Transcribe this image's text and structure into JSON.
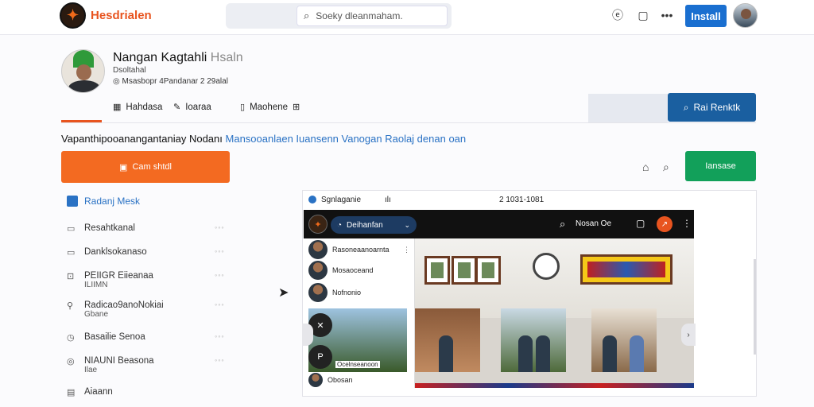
{
  "header": {
    "logo_glyph": "✦",
    "brand": "Hesdrialen",
    "search_placeholder": "Soeky dleanmaham.",
    "install_label": "Install",
    "icons": [
      "help-icon",
      "window-icon",
      "more-icon"
    ]
  },
  "profile": {
    "name": "Nangan Kagtahli",
    "name_suffix": "Hsaln",
    "line1": "Dsoltahal",
    "meta": "Msasbopr 4Pandanar 2 29alal",
    "tabs": [
      {
        "icon": "grid-icon",
        "label": "Hahdasa"
      },
      {
        "icon": "pencil-icon",
        "label": "Ioaraa"
      },
      {
        "icon": "book-icon",
        "label": "Maohene"
      }
    ],
    "tab_extra_icon": "⊞",
    "blue_button": "Rai Renktk",
    "description": "Vapanthipooanangantaniay Nodanı",
    "description_link": "Mansooanlaen Iuansenn Vanogan Raolaj denan oan",
    "orange_button": "Cam shtdl",
    "green_button": "Iansase"
  },
  "sidebar": {
    "heading": "Radanj Mesk",
    "items": [
      {
        "icon": "▭",
        "label": "Resahtkanal",
        "dots": "◦◦◦"
      },
      {
        "icon": "▭",
        "label": "Danklsokanaso",
        "dots": "◦◦◦"
      },
      {
        "icon": "⊡",
        "label": "PEIIGR Eiieanaa",
        "sub": "ILIIMN",
        "dots": "◦◦◦"
      },
      {
        "icon": "⚲",
        "label": "Radicao9anoNokiai",
        "sub": "Gbane",
        "dots": "◦◦◦"
      },
      {
        "icon": "◷",
        "label": "Basailie Senoa",
        "dots": "◦◦◦"
      },
      {
        "icon": "◎",
        "label": "NIAUNI Beasona",
        "sub": "Ilae",
        "dots": "◦◦◦"
      },
      {
        "icon": "▤",
        "label": "Aiaann",
        "dots": ""
      }
    ]
  },
  "panel": {
    "title": "Sgnlaganie",
    "bars": "ılı",
    "date": "2 1031-1081",
    "screen": {
      "logo_glyph": "✦",
      "pill_label": "Deihanfan",
      "right_text": "Nosan Oe",
      "dropdown_items": [
        "Rasoneaanoarnta",
        "Mosaoceand",
        "Nofnonio"
      ],
      "thumb_label": "Ocelnseanoon",
      "last_item": "Obosan",
      "play_glyph": "P"
    }
  },
  "colors": {
    "brand": "#e8541f",
    "primary_blue": "#1a6fd0",
    "green": "#12a05a",
    "link": "#2a72c4"
  }
}
